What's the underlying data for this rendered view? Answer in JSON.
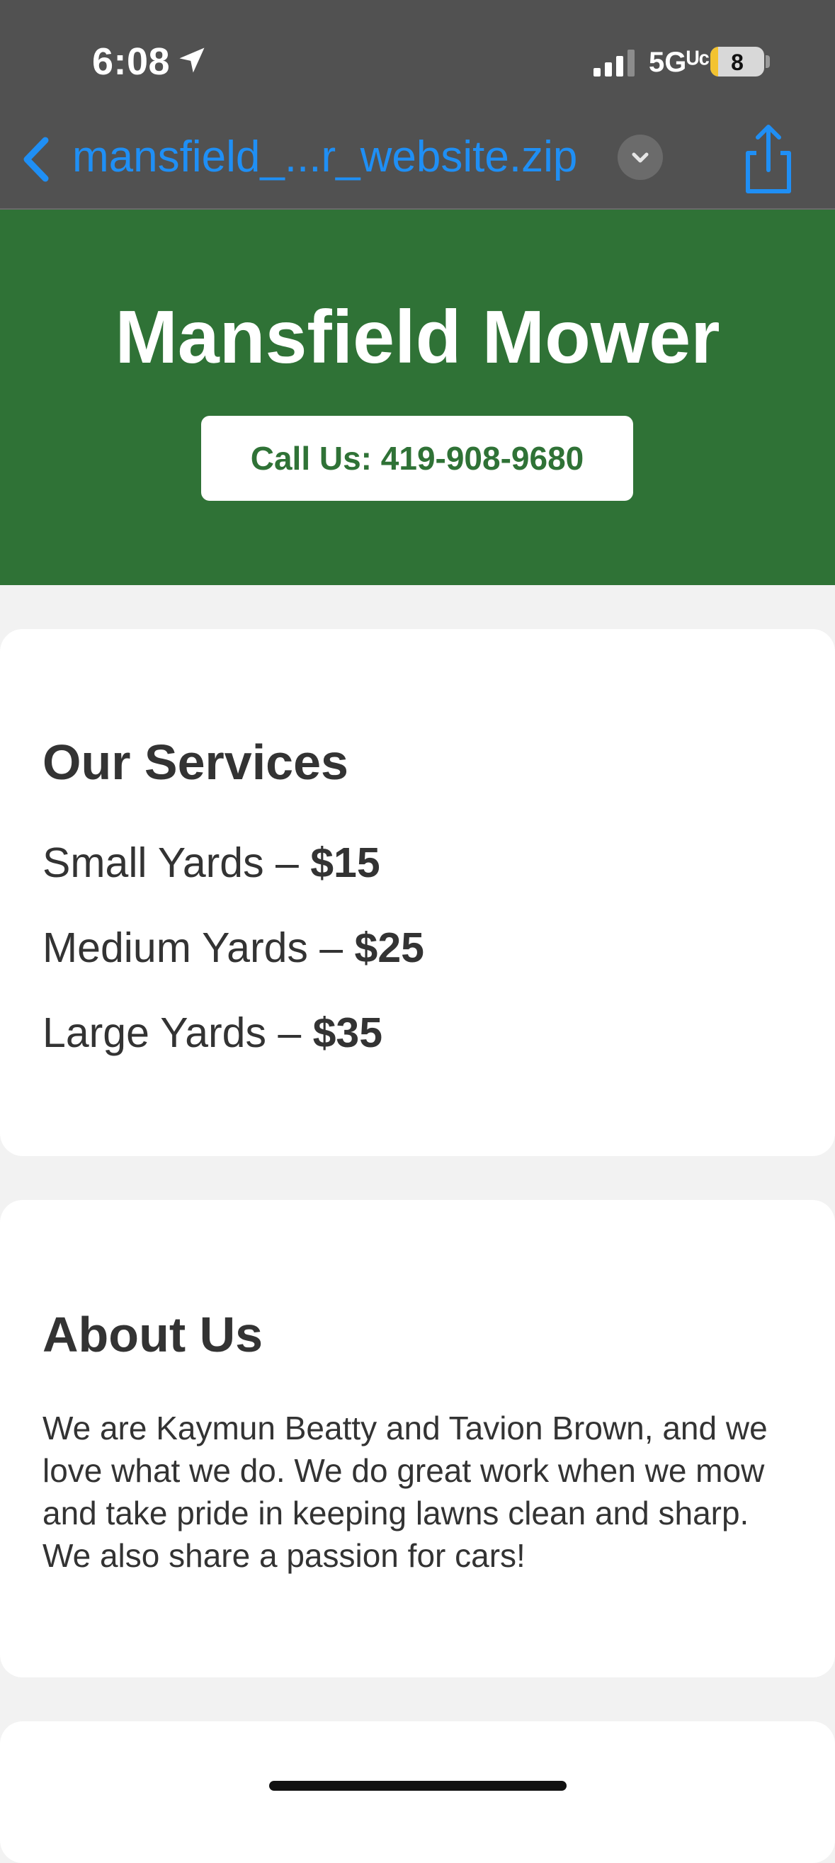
{
  "status_bar": {
    "time": "6:08",
    "network": "5Gᵁᶜ",
    "battery_level": "8",
    "icons": [
      "location-arrow-icon",
      "cellular-signal-icon",
      "battery-icon"
    ]
  },
  "nav_bar": {
    "file_title": "mansfield_...r_website.zip",
    "accent_color": "#1f8ff5",
    "icons": [
      "chevron-left-icon",
      "chevron-down-icon",
      "share-icon"
    ]
  },
  "hero": {
    "title": "Mansfield Mower",
    "call_button_label": "Call Us: 419-908-9680",
    "background_color": "#2f7236"
  },
  "services": {
    "heading": "Our Services",
    "items": [
      {
        "name": "Small Yards – ",
        "price": "$15"
      },
      {
        "name": "Medium Yards – ",
        "price": "$25"
      },
      {
        "name": "Large Yards – ",
        "price": "$35"
      }
    ]
  },
  "about": {
    "heading": "About Us",
    "text": "We are Kaymun Beatty and Tavion Brown, and we love what we do. We do great work when we mow and take pride in keeping lawns clean and sharp. We also share a passion for cars!"
  }
}
